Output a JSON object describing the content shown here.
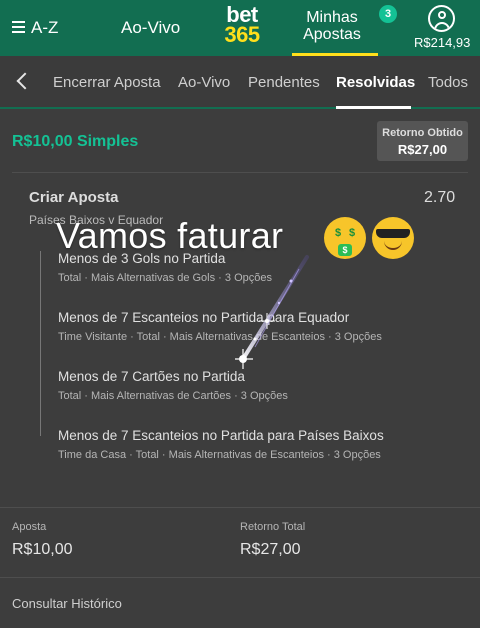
{
  "header": {
    "az_label": "A-Z",
    "aovivo_label": "Ao-Vivo",
    "logo_line1": "bet",
    "logo_line2": "365",
    "minhas_line1": "Minhas",
    "minhas_line2": "Apostas",
    "badge_count": "3",
    "balance": "R$214,93",
    "accent_color": "#126e51",
    "brand_yellow": "#ffdf1b"
  },
  "tabs": [
    {
      "label": "Encerrar Aposta"
    },
    {
      "label": "Ao-Vivo"
    },
    {
      "label": "Pendentes"
    },
    {
      "label": "Resolvidas",
      "active": true
    },
    {
      "label": "Todos"
    }
  ],
  "bet": {
    "title": "R$10,00 Simples",
    "retorno_obtido_label": "Retorno Obtido",
    "retorno_obtido_value": "R$27,00",
    "market": "Criar Aposta",
    "odds": "2.70",
    "event": "Países Baixos v Equador",
    "selections": [
      {
        "name": "Menos de 3 Gols no Partida",
        "desc": "Total · Mais Alternativas de Gols · 3 Opções"
      },
      {
        "name": "Menos de 7 Escanteios no Partida para Equador",
        "desc": "Time Visitante · Total · Mais Alternativas de Escanteios · 3 Opções"
      },
      {
        "name": "Menos de 7 Cartões no Partida",
        "desc": "Total · Mais Alternativas de Cartões · 3 Opções"
      },
      {
        "name": "Menos de 7 Escanteios no Partida para Países Baixos",
        "desc": "Time da Casa · Total · Mais Alternativas de Escanteios · 3 Opções"
      }
    ],
    "overlay_text": "Vamos faturar",
    "emojis": [
      "money-mouth-face-icon",
      "smiling-face-sunglasses-icon"
    ],
    "aposta_label": "Aposta",
    "aposta_value": "R$10,00",
    "retorno_total_label": "Retorno Total",
    "retorno_total_value": "R$27,00",
    "consultar_label": "Consultar Histórico",
    "stake_color": "#14c295"
  }
}
